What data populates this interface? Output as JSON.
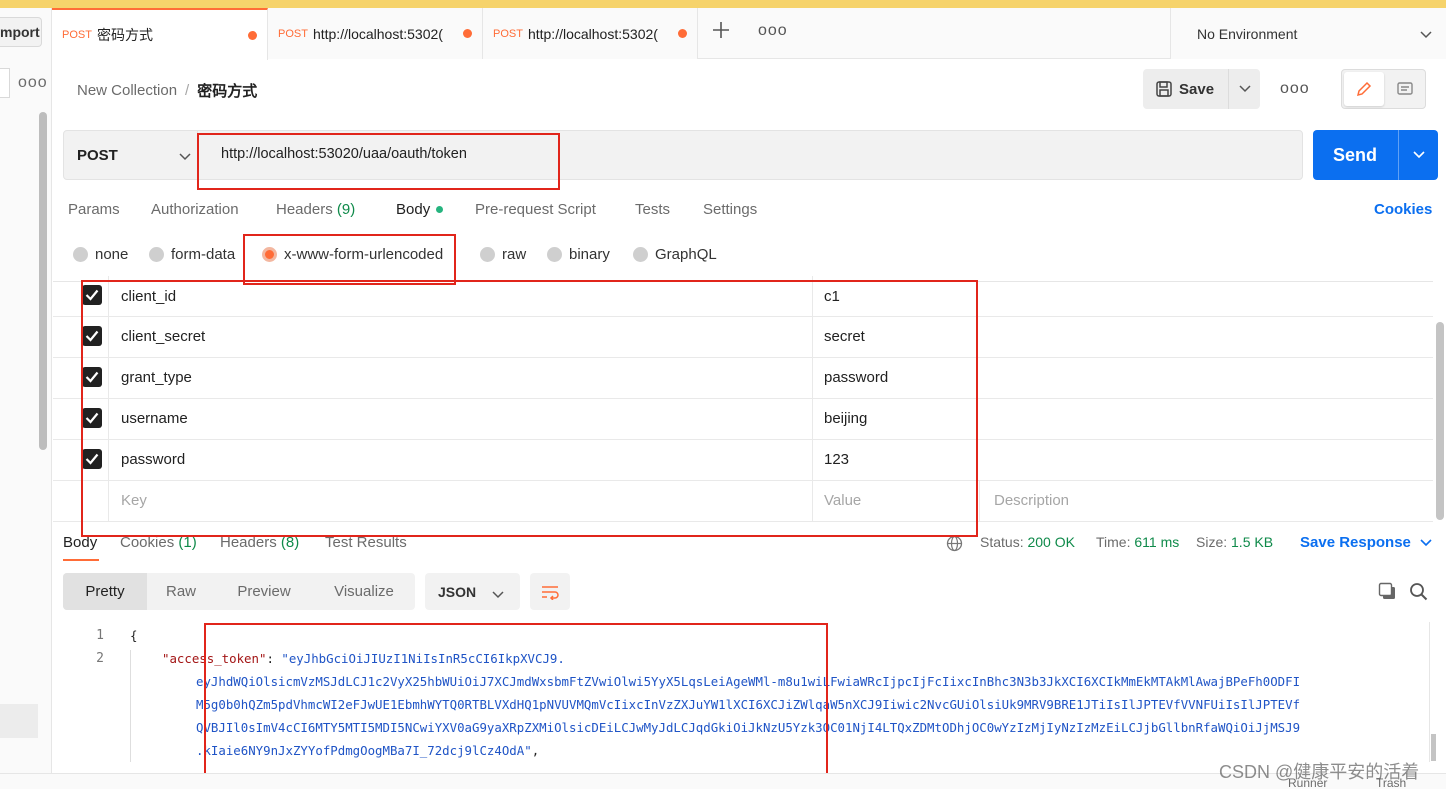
{
  "sidebar": {
    "import_label": "mport",
    "more": "ooo"
  },
  "tabs": [
    {
      "method": "POST",
      "name": "密码方式"
    },
    {
      "method": "POST",
      "name": "http://localhost:5302("
    },
    {
      "method": "POST",
      "name": "http://localhost:5302("
    }
  ],
  "tabs_more": "ooo",
  "environment": {
    "label": "No Environment"
  },
  "header": {
    "collection": "New Collection",
    "separator": "/",
    "request_name": "密码方式",
    "save_label": "Save",
    "more": "ooo"
  },
  "request": {
    "method": "POST",
    "url": "http://localhost:53020/uaa/oauth/token",
    "send_label": "Send"
  },
  "request_tabs": {
    "params": "Params",
    "authorization": "Authorization",
    "headers": "Headers",
    "headers_count": "(9)",
    "body": "Body",
    "prerequest": "Pre-request Script",
    "tests": "Tests",
    "settings": "Settings",
    "cookies": "Cookies"
  },
  "body_types": {
    "none": "none",
    "form_data": "form-data",
    "urlencoded": "x-www-form-urlencoded",
    "raw": "raw",
    "binary": "binary",
    "graphql": "GraphQL",
    "selected": "x-www-form-urlencoded"
  },
  "form_rows": [
    {
      "key": "client_id",
      "value": "c1",
      "checked": true
    },
    {
      "key": "client_secret",
      "value": "secret",
      "checked": true
    },
    {
      "key": "grant_type",
      "value": "password",
      "checked": true
    },
    {
      "key": "username",
      "value": "beijing",
      "checked": true
    },
    {
      "key": "password",
      "value": "123",
      "checked": true
    }
  ],
  "form_placeholders": {
    "key": "Key",
    "value": "Value",
    "description": "Description"
  },
  "response_tabs": {
    "body": "Body",
    "cookies": "Cookies",
    "cookies_count": "(1)",
    "headers": "Headers",
    "headers_count": "(8)",
    "test_results": "Test Results"
  },
  "response_meta": {
    "status_label": "Status:",
    "status_value": "200 OK",
    "time_label": "Time:",
    "time_value": "611 ms",
    "size_label": "Size:",
    "size_value": "1.5 KB",
    "save_response": "Save Response"
  },
  "response_view": {
    "modes": [
      "Pretty",
      "Raw",
      "Preview",
      "Visualize"
    ],
    "active_mode": "Pretty",
    "format": "JSON"
  },
  "response_code": {
    "line_numbers": [
      "1",
      "2"
    ],
    "open_brace": "{",
    "key": "\"access_token\"",
    "colon": ": ",
    "token_lines": [
      "\"eyJhbGciOiJIUzI1NiIsInR5cCI6IkpXVCJ9.",
      "eyJhdWQiOlsicmVzMSJdLCJ1c2VyX25hbWUiOiJ7XCJmdWxsbmFtZVwiOlwi5YyX5LqsLeiAgeWMl-m8u1wiLFwiaWRcIjpcIjFcIixcInBhc3N3b3JkXCI6XCIkMmEkMTAkMlAwajBPeFh0ODFI",
      "M5g0b0hQZm5pdVhmcWI2eFJwUE1EbmhWYTQ0RTBLVXdHQ1pNVUVMQmVcIixcInVzZXJuYW1lXCI6XCJiZWlqaW5nXCJ9Iiwic2NvcGUiOlsiUk9MRV9BRE1JTiIsIlJPTEVfVVNFUiIsIlJPTEVf",
      "QVBJIl0sImV4cCI6MTY5MTI5MDI5NCwiYXV0aG9yaXRpZXMiOlsicDEiLCJwMyJdLCJqdGkiOiJkNzU5Yzk3OC01NjI4LTQxZDMtODhjOC0wYzIzMjIyNzIzMzEiLCJjbGllbnRfaWQiOiJjMSJ9",
      ".kIaie6NY9nJxZYYofPdmgOogMBa7I_72dcj9lCz4OdA\""
    ],
    "trailing": ","
  },
  "status_bar": {
    "runner": "Runner",
    "trash": "Trash"
  },
  "watermark": "CSDN @健康平安的活着"
}
